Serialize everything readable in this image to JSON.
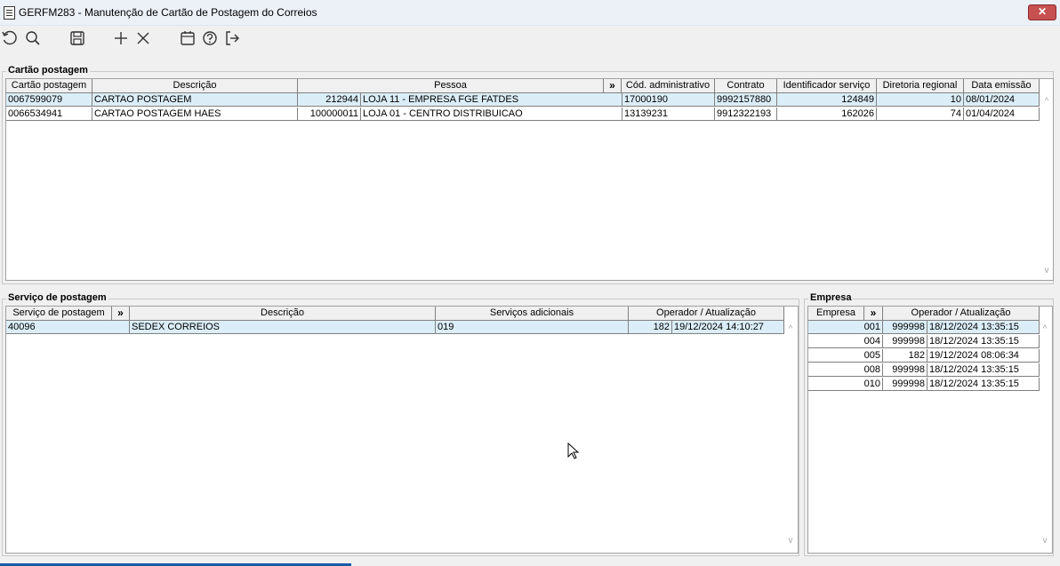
{
  "window": {
    "title": "GERFM283 - Manutenção de Cartão de Postagem do Correios",
    "close_label": "✕"
  },
  "toolbar": {
    "icons": [
      "undo-icon",
      "search-icon",
      "save-icon",
      "add-icon",
      "delete-icon",
      "calendar-icon",
      "help-icon",
      "exit-icon"
    ]
  },
  "cartao": {
    "label": "Cartão postagem",
    "headers": [
      "Cartão postagem",
      "Descrição",
      "Pessoa",
      "»",
      "Cód. administrativo",
      "Contrato",
      "Identificador serviço",
      "Diretoria regional",
      "Data emissão"
    ],
    "rows": [
      [
        "0067599079",
        "CARTAO POSTAGEM",
        "212944",
        "LOJA 11 - EMPRESA FGE FATDES",
        "17000190",
        "9992157880",
        "124849",
        "10",
        "08/01/2024"
      ],
      [
        "0066534941",
        "CARTAO POSTAGEM HAES",
        "100000011",
        "LOJA 01 - CENTRO DISTRIBUICAO",
        "13139231",
        "9912322193",
        "162026",
        "74",
        "01/04/2024"
      ]
    ]
  },
  "servico": {
    "label": "Serviço de postagem",
    "headers": [
      "Serviço de postagem",
      "»",
      "Descrição",
      "Serviços adicionais",
      "Operador / Atualização"
    ],
    "rows": [
      [
        "40096",
        "SEDEX CORREIOS",
        "019",
        "182",
        "19/12/2024 14:10:27"
      ]
    ]
  },
  "empresa": {
    "label": "Empresa",
    "headers": [
      "Empresa",
      "»",
      "Operador / Atualização"
    ],
    "rows": [
      [
        "001",
        "999998",
        "18/12/2024 13:35:15"
      ],
      [
        "004",
        "999998",
        "18/12/2024 13:35:15"
      ],
      [
        "005",
        "182",
        "19/12/2024 08:06:34"
      ],
      [
        "008",
        "999998",
        "18/12/2024 13:35:15"
      ],
      [
        "010",
        "999998",
        "18/12/2024 13:35:15"
      ]
    ]
  },
  "colors": {
    "selected_row": "#dbeef8",
    "close_button": "#c75050"
  }
}
